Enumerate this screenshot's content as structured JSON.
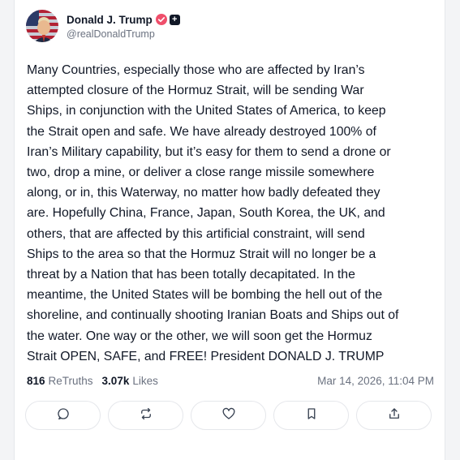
{
  "post": {
    "display_name": "Donald J. Trump",
    "handle": "@realDonaldTrump",
    "body": "Many Countries, especially those who are affected by Iran’s\nattempted closure of the Hormuz Strait, will be sending War\nShips, in conjunction with the United States of America, to keep\nthe Strait open and safe. We have already destroyed 100% of\nIran’s Military capability, but it’s easy for them to send a drone or\ntwo, drop a mine, or deliver a close range missile somewhere\nalong, or in, this Waterway, no matter how badly defeated they\nare. Hopefully China, France, Japan, South Korea, the UK, and\nothers, that are affected by this artificial constraint, will send\nShips to the area so that the Hormuz Strait will no longer be a\nthreat by a Nation that has been totally decapitated. In the\nmeantime, the United States will be bombing the hell out of the\nshoreline, and continually shooting Iranian Boats and Ships out of\nthe water. One way or the other, we will soon get the Hormuz\nStrait OPEN, SAFE, and FREE! President DONALD J. TRUMP",
    "stats": {
      "retruths_count": "816",
      "retruths_label": "ReTruths",
      "likes_count": "3.07k",
      "likes_label": "Likes"
    },
    "timestamp": "Mar 14, 2026, 11:04 PM"
  },
  "badges": {
    "verified_icon": "verified-check-icon",
    "plus_icon": "plus-icon",
    "verified_color": "#ef4f6b"
  },
  "actions": [
    {
      "name": "reply",
      "icon": "comment-icon"
    },
    {
      "name": "retruth",
      "icon": "repost-icon"
    },
    {
      "name": "like",
      "icon": "heart-icon"
    },
    {
      "name": "bookmark",
      "icon": "bookmark-icon"
    },
    {
      "name": "share",
      "icon": "share-icon"
    }
  ]
}
